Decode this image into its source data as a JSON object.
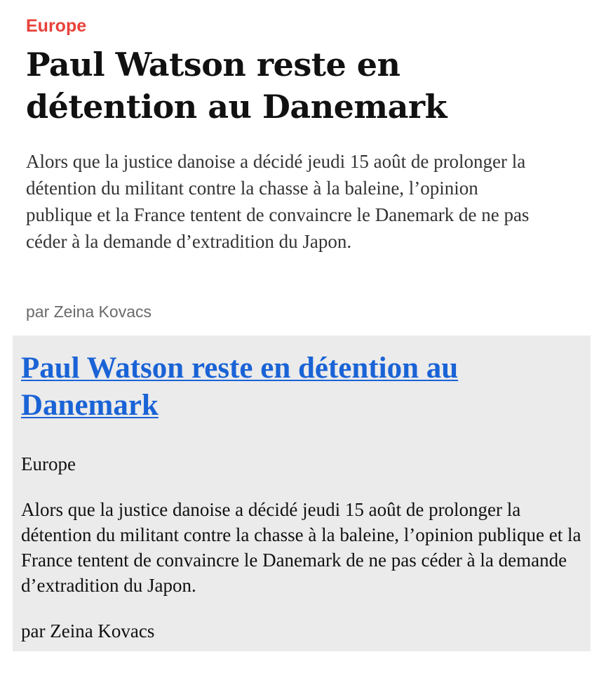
{
  "article": {
    "category": "Europe",
    "title": "Paul Watson reste en détention au Danemark",
    "lede": "Alors que la justice danoise a décidé jeudi 15 août de prolonger la détention du militant contre la chasse à la baleine, l’opinion publique et la France tentent de convaincre le Danemark de ne pas céder à la demande d’extradition du Japon.",
    "byline": "par Zeina Kovacs"
  },
  "fallback": {
    "title_link": "Paul Watson reste en détention au Danemark",
    "category": "Europe",
    "lede": "Alors que la justice danoise a décidé jeudi 15 août de prolonger la détention du militant contre la chasse à la baleine, l’opinion publique et la France tentent de convaincre le Danemark de ne pas céder à la demande d’extradition du Japon.",
    "byline": "par Zeina Kovacs"
  },
  "colors": {
    "category_accent": "#e8413a",
    "link": "#1a63d6",
    "fallback_background": "#ebebeb"
  }
}
